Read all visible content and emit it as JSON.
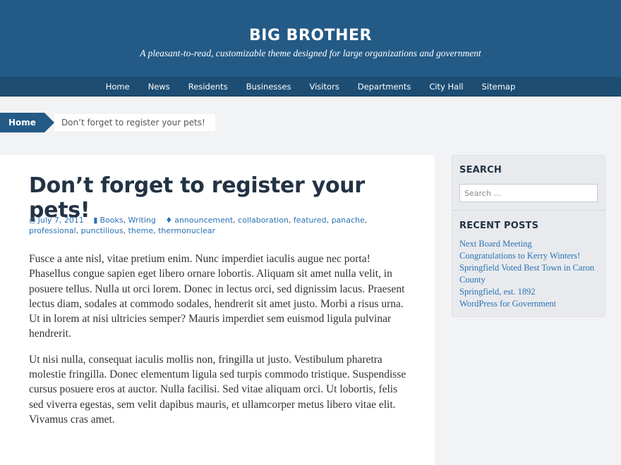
{
  "site": {
    "title": "BIG BROTHER",
    "tagline": "A pleasant-to-read, customizable theme designed for large organizations and government"
  },
  "nav": [
    {
      "label": "Home"
    },
    {
      "label": "News"
    },
    {
      "label": "Residents"
    },
    {
      "label": "Businesses"
    },
    {
      "label": "Visitors"
    },
    {
      "label": "Departments"
    },
    {
      "label": "City Hall"
    },
    {
      "label": "Sitemap"
    }
  ],
  "breadcrumb": {
    "home": "Home",
    "current": "Don’t forget to register your pets!"
  },
  "post": {
    "title": "Don’t forget to register your pets!",
    "date": "July 7, 2011",
    "categories": [
      "Books",
      "Writing"
    ],
    "tags": [
      "announcement",
      "collaboration",
      "featured",
      "panache",
      "professional",
      "punctilious",
      "theme",
      "thermonuclear"
    ],
    "icons": {
      "date": "clock-icon",
      "category": "folder-icon",
      "tag": "tag-icon"
    },
    "paragraphs": [
      "Fusce a ante nisl, vitae pretium enim. Nunc imperdiet iaculis augue nec porta! Phasellus congue sapien eget libero ornare lobortis. Aliquam sit amet nulla velit, in posuere tellus. Nulla ut orci lorem. Donec in lectus orci, sed dignissim lacus. Praesent lectus diam, sodales at commodo sodales, hendrerit sit amet justo. Morbi a risus urna. Ut in lorem at nisi ultricies semper? Mauris imperdiet sem euismod ligula pulvinar hendrerit.",
      "Ut nisi nulla, consequat iaculis mollis non, fringilla ut justo. Vestibulum pharetra molestie fringilla. Donec elementum ligula sed turpis commodo tristique. Suspendisse cursus posuere eros at auctor. Nulla facilisi. Sed vitae aliquam orci. Ut lobortis, felis sed viverra egestas, sem velit dapibus mauris, et ullamcorper metus libero vitae elit. Vivamus cras amet."
    ]
  },
  "sidebar": {
    "search": {
      "title": "SEARCH",
      "placeholder": "Search …"
    },
    "recent": {
      "title": "RECENT POSTS",
      "items": [
        "Next Board Meeting",
        "Congratulations to Kerry Winters!",
        "Springfield Voted Best Town in Caron County",
        "Springfield, est. 1892",
        "WordPress for Government"
      ]
    }
  },
  "colors": {
    "header": "#235a86",
    "nav": "#1d4d73",
    "link": "#2a72b5",
    "title": "#223344"
  }
}
